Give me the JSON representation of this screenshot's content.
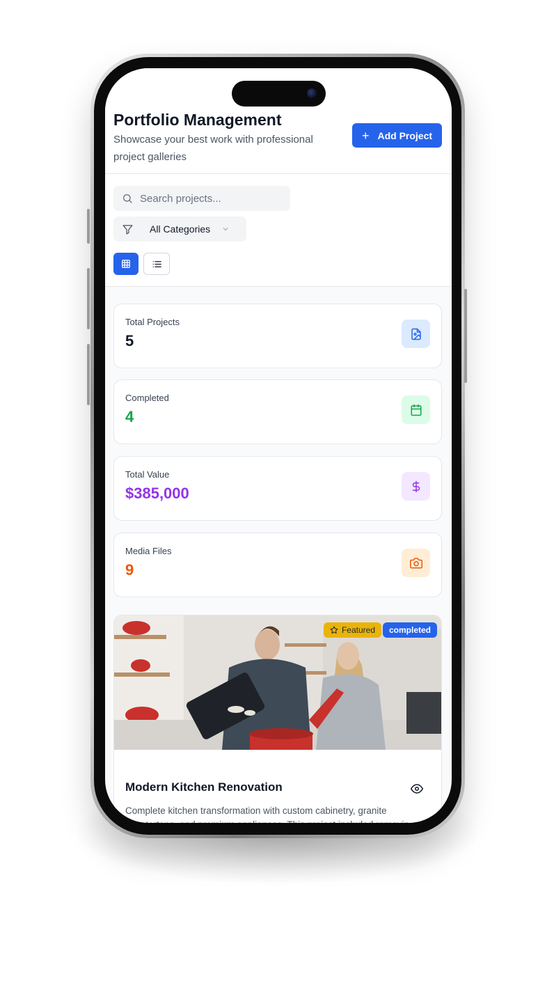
{
  "header": {
    "title": "Portfolio Management",
    "subtitle": "Showcase your best work with professional project galleries",
    "add_button": "Add Project"
  },
  "controls": {
    "search_placeholder": "Search projects...",
    "category_filter": "All Categories",
    "view_modes": [
      "grid",
      "list"
    ],
    "active_view": "grid"
  },
  "stats": [
    {
      "label": "Total Projects",
      "value": "5",
      "color": "#111827",
      "icon": "file-image-icon",
      "icon_bg": "#dbeafe",
      "icon_color": "#2563eb"
    },
    {
      "label": "Completed",
      "value": "4",
      "color": "#16a34a",
      "icon": "calendar-icon",
      "icon_bg": "#dcfce7",
      "icon_color": "#16a34a"
    },
    {
      "label": "Total Value",
      "value": "$385,000",
      "color": "#9333ea",
      "icon": "dollar-icon",
      "icon_bg": "#f3e8ff",
      "icon_color": "#9333ea"
    },
    {
      "label": "Media Files",
      "value": "9",
      "color": "#ea580c",
      "icon": "camera-icon",
      "icon_bg": "#ffedd5",
      "icon_color": "#ea580c"
    }
  ],
  "project": {
    "featured_badge": "Featured",
    "status_badge": "completed",
    "title": "Modern Kitchen Renovation",
    "description": "Complete kitchen transformation with custom cabinetry, granite countertops, and premium appliances. This project included removin"
  },
  "colors": {
    "accent": "#2563eb",
    "featured": "#eab308"
  }
}
